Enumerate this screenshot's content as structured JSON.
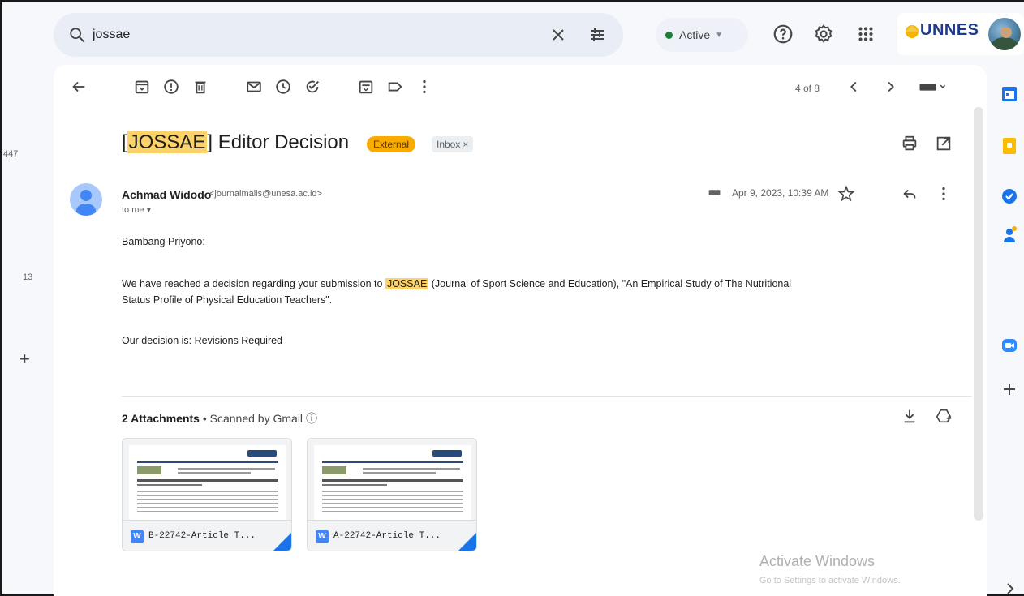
{
  "search": {
    "query": "jossae"
  },
  "status": {
    "label": "Active",
    "dot_color": "#188038"
  },
  "brand": {
    "name": "UNNES"
  },
  "left_rail": {
    "count_a": "447",
    "count_b": "13",
    "add": "+"
  },
  "toolbar": {
    "pager": "4 of 8"
  },
  "email": {
    "subject_bracket_open": "[",
    "subject_highlight": "JOSSAE",
    "subject_rest": "] Editor Decision",
    "label_external": "External",
    "label_inbox": "Inbox",
    "label_inbox_close": "×",
    "sender_name": "Achmad Widodo",
    "sender_email": "<journalmails@unesa.ac.id>",
    "to": "to me",
    "date": "Apr 9, 2023, 10:39 AM",
    "greeting": "Bambang Priyono:",
    "para1_before": "We have reached a decision regarding your submission to ",
    "para1_highlight": "JOSSAE",
    "para1_after": " (Journal of Sport Science and Education), \"An Empirical Study of The Nutritional",
    "para1_line2": "Status Profile of Physical Education Teachers\".",
    "decision": "Our decision is: Revisions Required"
  },
  "attachments": {
    "count_label": "2 Attachments",
    "separator": " • ",
    "scanned": "Scanned by Gmail",
    "items": [
      {
        "name": "B-22742-Article T..."
      },
      {
        "name": "A-22742-Article T..."
      }
    ]
  },
  "watermark": {
    "title": "Activate Windows",
    "subtitle": "Go to Settings to activate Windows."
  },
  "colors": {
    "highlight": "#fcd36a",
    "external_label": "#f9ab00",
    "accent": "#1a73e8"
  }
}
